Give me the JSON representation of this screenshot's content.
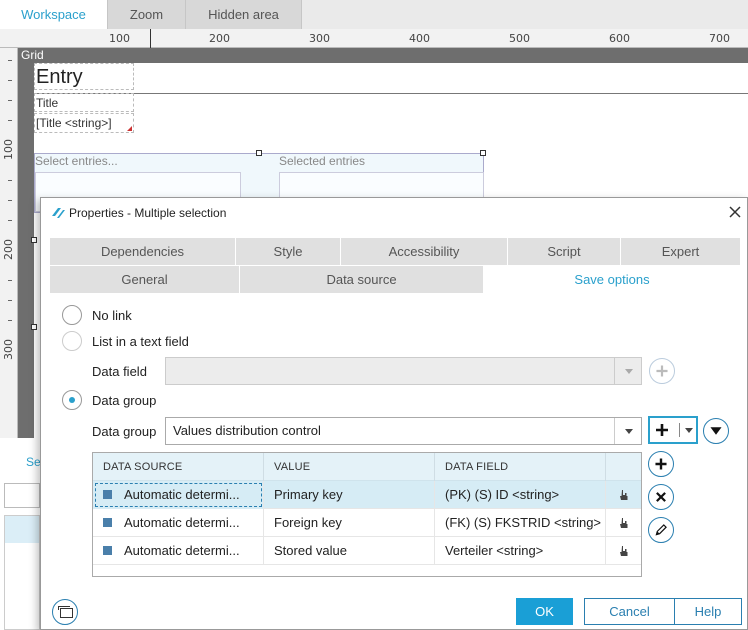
{
  "top_tabs": {
    "workspace": "Workspace",
    "zoom": "Zoom",
    "hidden_area": "Hidden area"
  },
  "ruler": {
    "h_labels": [
      "100",
      "200",
      "300",
      "400",
      "500",
      "600",
      "700"
    ],
    "v_labels": [
      "100",
      "200",
      "300"
    ]
  },
  "canvas": {
    "grid_label": "Grid",
    "entry_title": "Entry",
    "title_label": "Title",
    "title_field": "[Title <string>]",
    "select_entries": "Select entries...",
    "selected_entries": "Selected entries",
    "bg_text": "Se"
  },
  "dialog": {
    "title": "Properties - Multiple selection",
    "tabs_row1": [
      "Dependencies",
      "Style",
      "Accessibility",
      "Script",
      "Expert"
    ],
    "tabs_row2": [
      "General",
      "Data source",
      "Save options"
    ],
    "active_tab": "Save options",
    "options": {
      "no_link": "No link",
      "list_text_field": "List in a text field",
      "data_field_label": "Data field",
      "data_field_value": "",
      "data_group": "Data group",
      "data_group_label": "Data group",
      "data_group_value": "Values distribution control"
    },
    "grid": {
      "headers": [
        "DATA SOURCE",
        "VALUE",
        "DATA FIELD"
      ],
      "rows": [
        {
          "source": "Automatic determi...",
          "value": "Primary key",
          "field": "(PK) (S) ID <string>"
        },
        {
          "source": "Automatic determi...",
          "value": "Foreign key",
          "field": "(FK) (S) FKSTRID <string>"
        },
        {
          "source": "Automatic determi...",
          "value": "Stored value",
          "field": "Verteiler <string>"
        }
      ]
    },
    "buttons": {
      "ok": "OK",
      "cancel": "Cancel",
      "help": "Help"
    }
  },
  "icons": {
    "close": "close-icon",
    "add": "plus-icon",
    "filter": "filter-icon",
    "remove": "x-icon",
    "edit": "pencil-icon",
    "thumb": "pointer-hand-icon",
    "footer": "window-icon"
  },
  "colors": {
    "accent": "#2aa0cc",
    "primary_button": "#1a9fd6",
    "selected_row": "#d6ecf5",
    "grid_header": "#e4f2f8",
    "canvas_dark": "#6e6e6e"
  }
}
